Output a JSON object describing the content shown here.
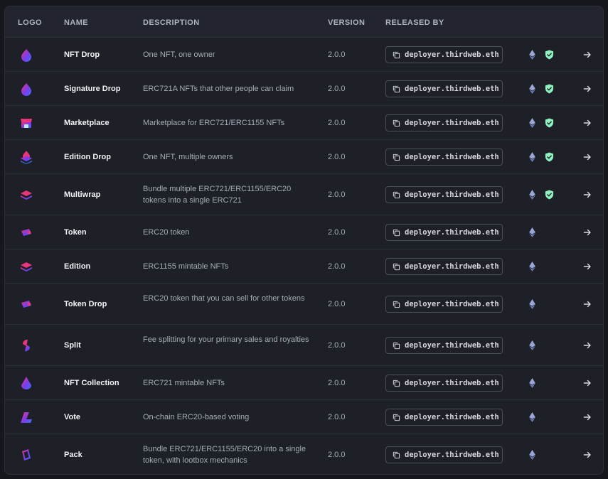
{
  "headers": {
    "logo": "LOGO",
    "name": "NAME",
    "description": "DESCRIPTION",
    "version": "VERSION",
    "released_by": "RELEASED BY"
  },
  "rows": [
    {
      "logo": "nft-drop-logo",
      "name": "NFT Drop",
      "description": "One NFT, one owner",
      "version": "2.0.0",
      "released_by": "deployer.thirdweb.eth",
      "verified": true
    },
    {
      "logo": "signature-drop-logo",
      "name": "Signature Drop",
      "description": "ERC721A NFTs that other people can claim",
      "version": "2.0.0",
      "released_by": "deployer.thirdweb.eth",
      "verified": true
    },
    {
      "logo": "marketplace-logo",
      "name": "Marketplace",
      "description": "Marketplace for ERC721/ERC1155 NFTs",
      "version": "2.0.0",
      "released_by": "deployer.thirdweb.eth",
      "verified": true
    },
    {
      "logo": "edition-drop-logo",
      "name": "Edition Drop",
      "description": "One NFT, multiple owners",
      "version": "2.0.0",
      "released_by": "deployer.thirdweb.eth",
      "verified": true
    },
    {
      "logo": "multiwrap-logo",
      "name": "Multiwrap",
      "description": "Bundle multiple ERC721/ERC1155/ERC20 tokens into a single ERC721",
      "version": "2.0.0",
      "released_by": "deployer.thirdweb.eth",
      "verified": true
    },
    {
      "logo": "token-logo",
      "name": "Token",
      "description": "ERC20 token",
      "version": "2.0.0",
      "released_by": "deployer.thirdweb.eth",
      "verified": false
    },
    {
      "logo": "edition-logo",
      "name": "Edition",
      "description": "ERC1155 mintable NFTs",
      "version": "2.0.0",
      "released_by": "deployer.thirdweb.eth",
      "verified": false
    },
    {
      "logo": "token-drop-logo",
      "name": "Token Drop",
      "description": "ERC20 token that you can sell for other tokens",
      "version": "2.0.0",
      "released_by": "deployer.thirdweb.eth",
      "verified": false
    },
    {
      "logo": "split-logo",
      "name": "Split",
      "description": "Fee splitting for your primary sales and royalties",
      "version": "2.0.0",
      "released_by": "deployer.thirdweb.eth",
      "verified": false
    },
    {
      "logo": "nft-collection-logo",
      "name": "NFT Collection",
      "description": "ERC721 mintable NFTs",
      "version": "2.0.0",
      "released_by": "deployer.thirdweb.eth",
      "verified": false
    },
    {
      "logo": "vote-logo",
      "name": "Vote",
      "description": "On-chain ERC20-based voting",
      "version": "2.0.0",
      "released_by": "deployer.thirdweb.eth",
      "verified": false
    },
    {
      "logo": "pack-logo",
      "name": "Pack",
      "description": "Bundle ERC721/ERC1155/ERC20 into a single token, with lootbox mechanics",
      "version": "2.0.0",
      "released_by": "deployer.thirdweb.eth",
      "verified": false
    }
  ],
  "icons": {
    "copy": "copy-icon",
    "ethereum": "ethereum-icon",
    "verified": "shield-check-icon",
    "open": "arrow-right-icon"
  },
  "colors": {
    "logo_pink": "#e9357a",
    "logo_purple": "#7b3cf0",
    "logo_blue": "#3d6ff5",
    "verified_green": "#8ff0c0"
  }
}
